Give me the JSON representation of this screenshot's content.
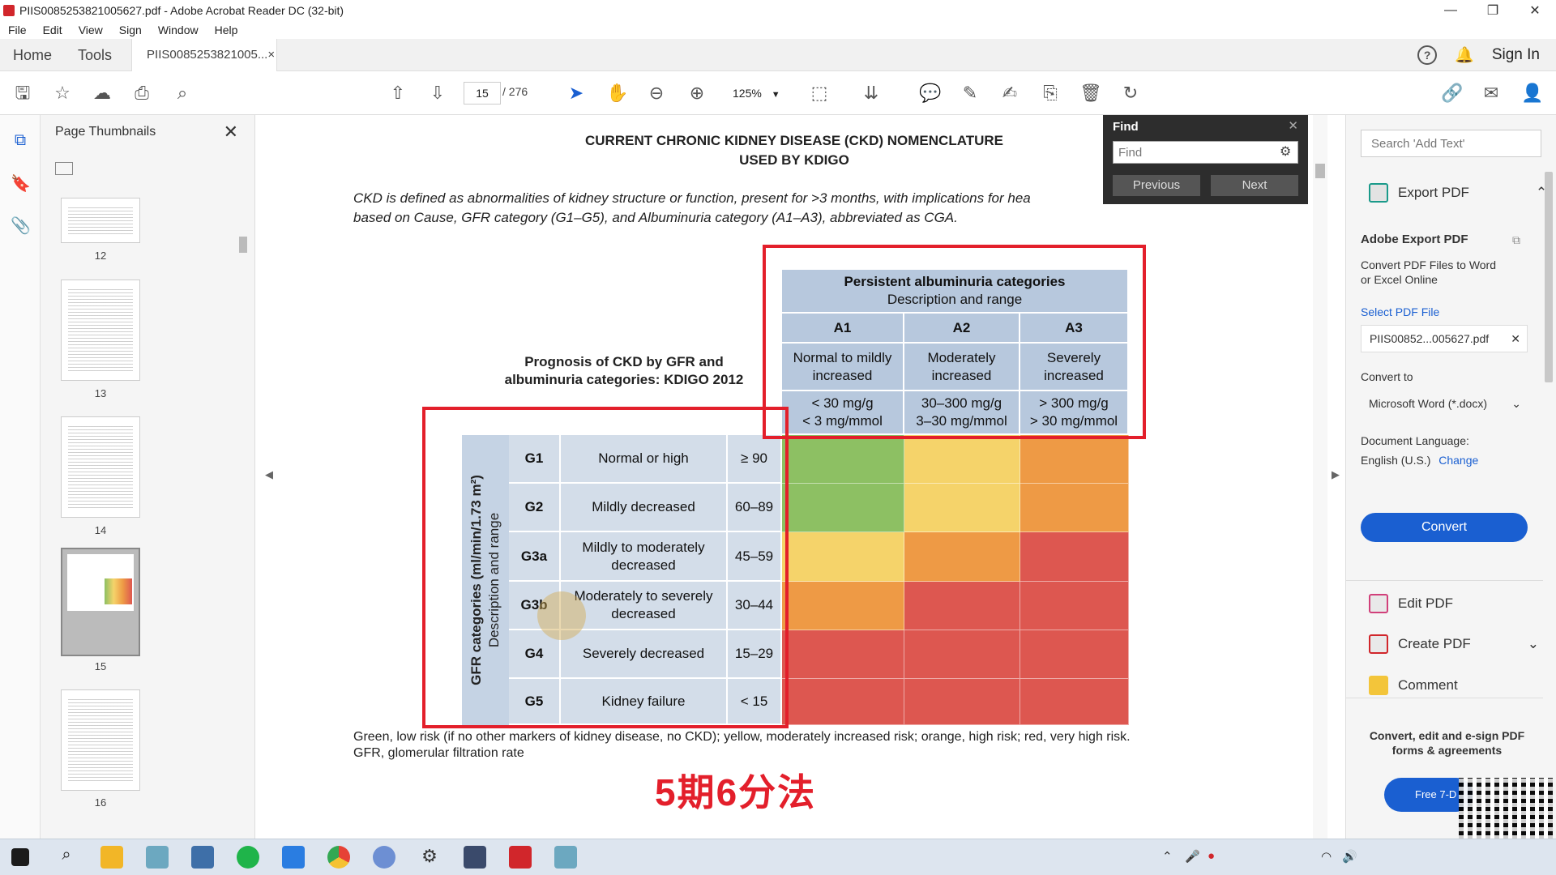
{
  "window": {
    "title": "PIIS0085253821005627.pdf - Adobe Acrobat Reader DC (32-bit)",
    "minimize": "—",
    "maximize": "❐",
    "close": "✕"
  },
  "menu": [
    "File",
    "Edit",
    "View",
    "Sign",
    "Window",
    "Help"
  ],
  "tabs": {
    "home": "Home",
    "tools": "Tools",
    "doc": "PIIS0085253821005...",
    "doc_close": "×",
    "sign_in": "Sign In"
  },
  "toolbar": {
    "page_current": "15",
    "page_total": "/ 276",
    "zoom": "125%"
  },
  "thumbnails": {
    "header": "Page Thumbnails",
    "pages": [
      "12",
      "13",
      "14",
      "15",
      "16"
    ],
    "selected": "15"
  },
  "document": {
    "title_line1": "CURRENT CHRONIC KIDNEY DISEASE (CKD) NOMENCLATURE",
    "title_line2": "USED BY KDIGO",
    "intro_line1": "CKD is defined as abnormalities of kidney structure or function, present for >3 months, with implications for hea",
    "intro_line2": "based on Cause, GFR category (G1–G5), and Albuminuria category (A1–A3), abbreviated as CGA.",
    "prognosis_title_line1": "Prognosis of CKD by GFR and",
    "prognosis_title_line2": "albuminuria categories: KDIGO 2012",
    "albuminuria_header_line1": "Persistent albuminuria categories",
    "albuminuria_header_line2": "Description and range",
    "a_cols": [
      {
        "code": "A1",
        "desc": "Normal to mildly increased",
        "range1": "< 30 mg/g",
        "range2": "< 3 mg/mmol"
      },
      {
        "code": "A2",
        "desc": "Moderately increased",
        "range1": "30–300 mg/g",
        "range2": "3–30 mg/mmol"
      },
      {
        "code": "A3",
        "desc": "Severely increased",
        "range1": "> 300 mg/g",
        "range2": "> 30 mg/mmol"
      }
    ],
    "gfr_axis_line1": "GFR categories (ml/min/1.73 m²)",
    "gfr_axis_line2": "Description and range",
    "g_rows": [
      {
        "code": "G1",
        "desc": "Normal or high",
        "range": "≥ 90",
        "colors": [
          "green",
          "yellow",
          "orange"
        ]
      },
      {
        "code": "G2",
        "desc": "Mildly decreased",
        "range": "60–89",
        "colors": [
          "green",
          "yellow",
          "orange"
        ]
      },
      {
        "code": "G3a",
        "desc": "Mildly to moderately decreased",
        "range": "45–59",
        "colors": [
          "yellow",
          "orange",
          "red"
        ]
      },
      {
        "code": "G3b",
        "desc": "Moderately to severely decreased",
        "range": "30–44",
        "colors": [
          "orange",
          "red",
          "red"
        ]
      },
      {
        "code": "G4",
        "desc": "Severely decreased",
        "range": "15–29",
        "colors": [
          "red",
          "red",
          "red"
        ]
      },
      {
        "code": "G5",
        "desc": "Kidney failure",
        "range": "< 15",
        "colors": [
          "red",
          "red",
          "red"
        ]
      }
    ],
    "footnote_line1": "Green, low risk (if no other markers of kidney disease, no CKD); yellow, moderately increased risk; orange, high risk; red, very high risk.",
    "footnote_line2": "GFR, glomerular filtration rate",
    "annotation_cn": "5期6分法"
  },
  "find": {
    "title": "Find",
    "placeholder": "Find",
    "previous": "Previous",
    "next": "Next"
  },
  "right_panel": {
    "search_placeholder": "Search 'Add Text'",
    "export_pdf": "Export PDF",
    "adobe_export_title": "Adobe Export PDF",
    "desc_line1": "Convert PDF Files to Word",
    "desc_line2": "or Excel Online",
    "select_file": "Select PDF File",
    "file_name": "PIIS00852...005627.pdf",
    "convert_to": "Convert to",
    "format": "Microsoft Word (*.docx)",
    "doc_lang": "Document Language:",
    "lang": "English (U.S.)",
    "change": "Change",
    "convert": "Convert",
    "edit_pdf": "Edit PDF",
    "create_pdf": "Create PDF",
    "comment": "Comment",
    "promo_line1": "Convert, edit and e-sign PDF",
    "promo_line2": "forms & agreements",
    "free_trial": "Free 7-D"
  },
  "colors": {
    "green": "#8dc063",
    "yellow": "#f5d36a",
    "orange": "#ee9a45",
    "red": "#dd5750",
    "accent": "#1a5fd1",
    "highlight_box": "#e31f2b"
  }
}
